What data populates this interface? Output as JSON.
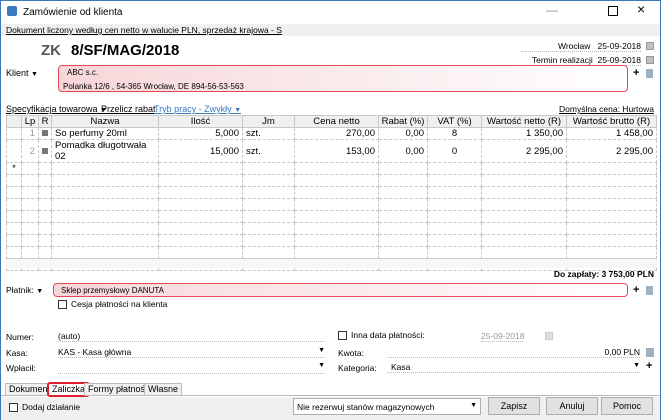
{
  "window": {
    "title": "Zamówienie od klienta",
    "info": "Dokument liczony według cen netto w walucie PLN, sprzedaż krajowa - S"
  },
  "header": {
    "prefix": "ZK",
    "number": "8/SF/MAG/2018",
    "place": "Wrocław",
    "date": "25-09-2018",
    "term_label": "Termin realizacji",
    "term_date": "25-09-2018"
  },
  "client": {
    "label": "Klient",
    "name": "ABC s.c.",
    "address": "Polanka  12/6 , 54-365 Wrocław, DE 894-56-53-563"
  },
  "toolbar": {
    "spec": "Specyfikacja towarowa",
    "recalc": "Przelicz rabat",
    "mode": "Tryb pracy - Zwykły",
    "default_price": "Domyślna cena: Hurtowa"
  },
  "table": {
    "headers": [
      "Lp",
      "R",
      "Nazwa",
      "Ilość",
      "Jm",
      "Cena netto",
      "Rabat (%)",
      "VAT (%)",
      "Wartość netto (R)",
      "Wartość brutto (R)"
    ],
    "rows": [
      [
        "1",
        "",
        "So perfumy 20ml",
        "5,000",
        "szt.",
        "270,00",
        "0,00",
        "8",
        "1 350,00",
        "1 458,00"
      ],
      [
        "2",
        "",
        "Pomadka długotrwała 02",
        "15,000",
        "szt.",
        "153,00",
        "0,00",
        "0",
        "2 295,00",
        "2 295,00"
      ]
    ],
    "new_row": "*"
  },
  "total": "Do zapłaty: 3 753,00 PLN",
  "payer": {
    "label": "Płatnik:",
    "name": "Sklep przemysłowy DANUTA",
    "cession": "Cesja płatności na klienta"
  },
  "payment": {
    "numer_label": "Numer:",
    "numer": "(auto)",
    "kasa_label": "Kasa:",
    "kasa": "KAS - Kasa główna",
    "wplacil_label": "Wpłacił:",
    "other_date": "Inna data płatności:",
    "other_date_value": "25-09-2018",
    "kwota_label": "Kwota:",
    "kwota": "0,00 PLN",
    "kategoria_label": "Kategoria:",
    "kategoria": "Kasa"
  },
  "tabs": [
    "Dokument",
    "Zaliczka",
    "Formy płatności",
    "Własne"
  ],
  "footer": {
    "add_action": "Dodaj działanie",
    "reserve": "Nie rezerwuj stanów magazynowych",
    "save": "Zapisz",
    "cancel": "Anuluj",
    "help": "Pomoc"
  }
}
